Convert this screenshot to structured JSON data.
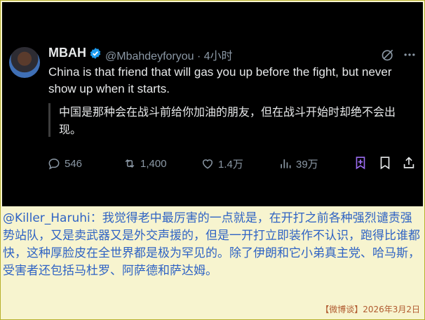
{
  "tweet": {
    "author": "MBAH",
    "handle_time": "@Mbahdeyforyou · 4小时",
    "text": "China is that friend that will gas you up before the fight, but never show up when it starts.",
    "translation": "中国是那种会在战斗前给你加油的朋友，但在战斗开始时却绝不会出现。",
    "actions": {
      "replies": "546",
      "reposts": "1,400",
      "likes": "1.4万",
      "views": "39万"
    },
    "colors": {
      "background": "#000000",
      "text": "#e7e9ea",
      "secondary": "#8b98a5",
      "verified": "#1d9bf0",
      "highlight": "#9b6cf0"
    }
  },
  "comment": {
    "text": "@Killer_Haruhi：我觉得老中最厉害的一点就是，在开打之前各种强烈谴责强势站队，又是卖武器又是外交声援的，但是一开打立即装作不认识，跑得比谁都快，这种厚脸皮在全世界都是极为罕见的。除了伊朗和它小弟真主党、哈马斯，受害者还包括马杜罗、阿萨德和萨达姆。",
    "color": "#2f63c4"
  },
  "footer": {
    "text": "【微博谈】2026年3月2日"
  },
  "icons": [
    "avatar",
    "verified-badge-icon",
    "grok-icon",
    "more-icon",
    "reply-icon",
    "repost-icon",
    "like-icon",
    "views-icon",
    "bookmark-icon",
    "share-icon"
  ]
}
